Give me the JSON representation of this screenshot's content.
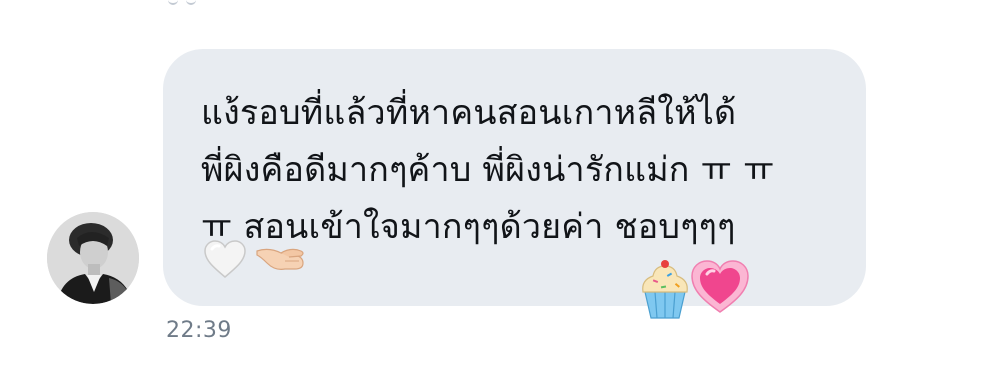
{
  "message": {
    "lines": [
      "แง้รอบที่แล้วที่หาคนสอนเกาหลีให้ได้",
      "พี่ผิงคือดีมากๆค้าบ พี่ผิงน่ารักแม่ก ㅠ ㅠ",
      "ㅠ สอนเข้าใจมากๆๆด้วยค่า ชอบๆๆๆ"
    ],
    "inline_emojis": [
      "white-heart",
      "pinching-hand"
    ],
    "timestamp": "22:39"
  },
  "reactions": [
    "cupcake",
    "pink-heart"
  ],
  "colors": {
    "bubble": "#e8ecf1",
    "text": "#111418",
    "timestamp": "#6f7b88"
  }
}
